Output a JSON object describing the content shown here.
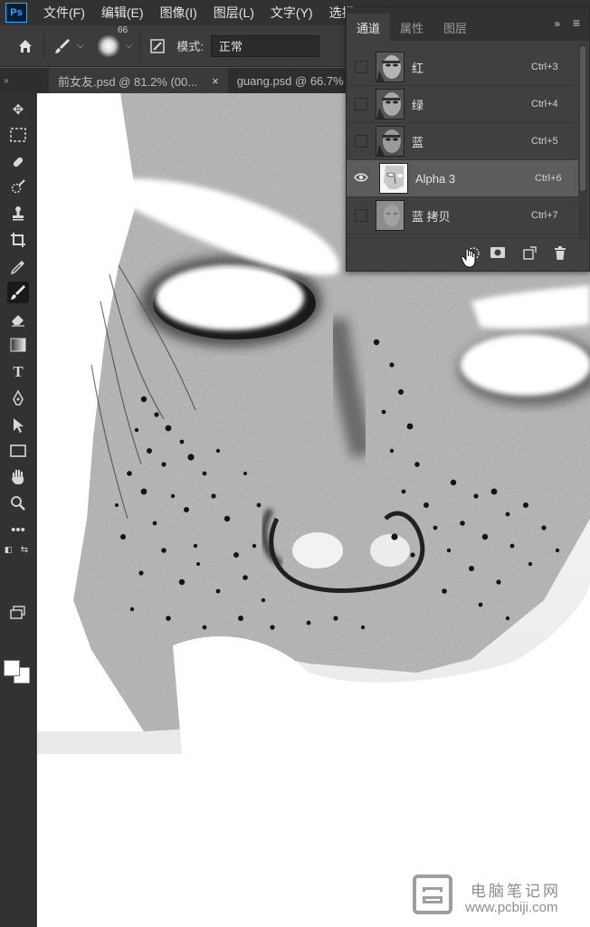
{
  "app": {
    "logo": "Ps",
    "menu": [
      "文件(F)",
      "编辑(E)",
      "图像(I)",
      "图层(L)",
      "文字(Y)",
      "选择"
    ]
  },
  "options": {
    "brush_size": "66",
    "mode_label": "模式:",
    "mode_value": "正常"
  },
  "documents": {
    "tabs": [
      {
        "label": "前女友.psd @ 81.2% (00...",
        "close": "×"
      },
      {
        "label": "guang.psd @ 66.7%"
      }
    ]
  },
  "channels_panel": {
    "tabs": [
      "通道",
      "属性",
      "图层"
    ],
    "menu_icon": "»",
    "rows": [
      {
        "name": "红",
        "shortcut": "Ctrl+3",
        "visible": false
      },
      {
        "name": "绿",
        "shortcut": "Ctrl+4",
        "visible": false
      },
      {
        "name": "蓝",
        "shortcut": "Ctrl+5",
        "visible": false
      },
      {
        "name": "Alpha 3",
        "shortcut": "Ctrl+6",
        "visible": true,
        "selected": true
      },
      {
        "name": "蓝 拷贝",
        "shortcut": "Ctrl+7",
        "visible": false
      }
    ]
  },
  "watermark": {
    "title": "电脑笔记网",
    "url": "www.pcbiji.com"
  }
}
